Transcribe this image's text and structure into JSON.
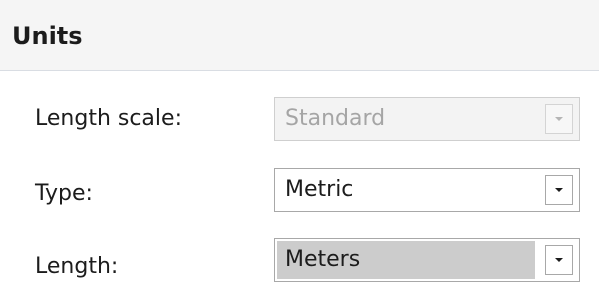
{
  "header": {
    "title": "Units"
  },
  "fields": [
    {
      "label": "Length scale:",
      "value": "Standard",
      "enabled": false,
      "dropdown_icon": "chevron-down-icon"
    },
    {
      "label": "Type:",
      "value": "Metric",
      "enabled": true,
      "dropdown_icon": "chevron-down-icon"
    },
    {
      "label": "Length:",
      "value": "Meters",
      "enabled": true,
      "selected": true,
      "dropdown_icon": "chevron-down-icon"
    }
  ],
  "colors": {
    "header_bg": "#f5f5f5",
    "header_border": "#d9dde3",
    "disabled_text": "#a5a5a5",
    "selection_bg": "#cccccc",
    "text": "#1c1c1c"
  }
}
